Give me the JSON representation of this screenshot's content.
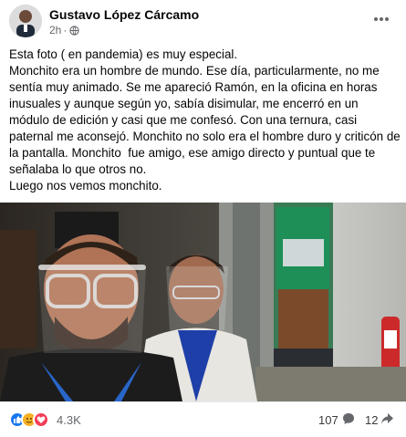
{
  "post": {
    "author": "Gustavo López Cárcamo",
    "time": "2h",
    "separator": "·",
    "audience_icon": "globe-icon",
    "more_icon": "more-options-icon",
    "text": [
      "Esta foto ( en pandemia) es muy especial.",
      "Monchito era un hombre de mundo. Ese día, particularmente, no me sentía muy animado. Se me apareció Ramón, en la oficina en horas inusuales y aunque según yo, sabía disimular, me encerró en un módulo de edición y casi que me confesó. Con una ternura, casi paternal me aconsejó. Monchito no solo era el hombre duro y criticón de la pantalla. Monchito  fue amigo, ese amigo directo y puntual que te señalaba lo que otros no.",
      "Luego nos vemos monchito."
    ]
  },
  "engagement": {
    "reaction_icons": [
      "like-icon",
      "care-icon",
      "love-icon"
    ],
    "reaction_count": "4.3K",
    "comment_count": "107",
    "comment_icon": "comment-icon",
    "share_count": "12",
    "share_icon": "share-icon"
  },
  "colors": {
    "like": "#1877f2",
    "care": "#f7b125",
    "love": "#f33e58",
    "secondary_text": "#65676b"
  }
}
